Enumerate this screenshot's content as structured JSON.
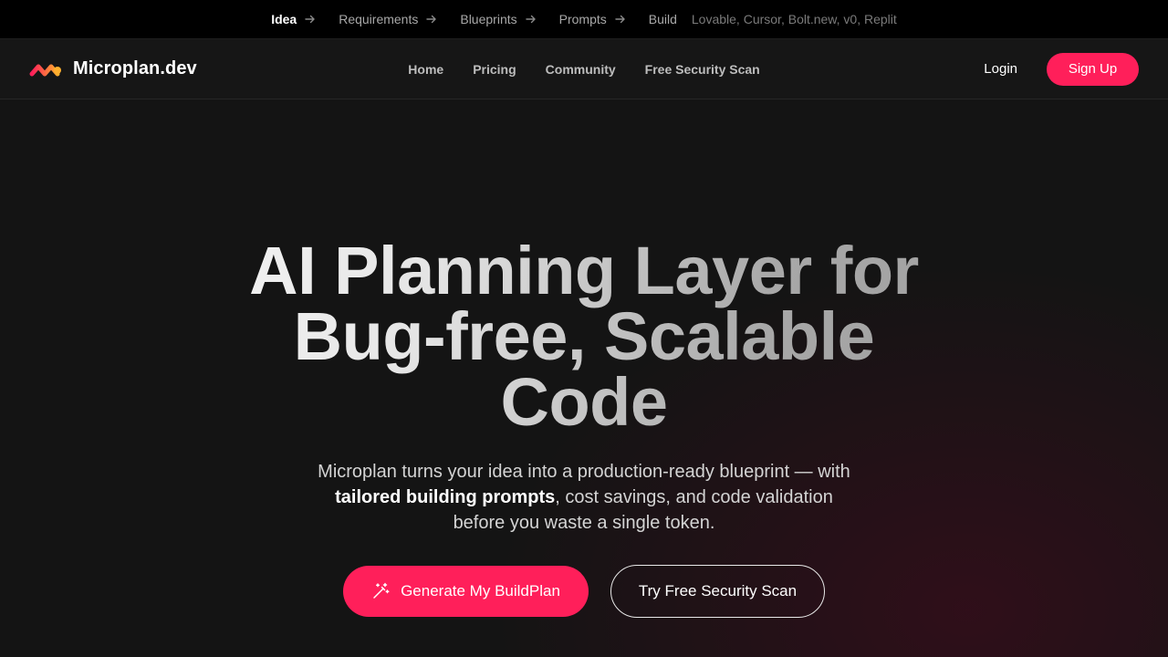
{
  "topbar": {
    "steps": [
      {
        "label": "Idea"
      },
      {
        "label": "Requirements"
      },
      {
        "label": "Blueprints"
      },
      {
        "label": "Prompts"
      },
      {
        "label": "Build"
      }
    ],
    "tools": "Lovable, Cursor, Bolt.new, v0, Replit"
  },
  "nav": {
    "brand": "Microplan.dev",
    "links": [
      "Home",
      "Pricing",
      "Community",
      "Free Security Scan"
    ],
    "login": "Login",
    "signup": "Sign Up"
  },
  "hero": {
    "headline": [
      "AI Planning Layer for",
      "Bug-free, Scalable",
      "Code"
    ],
    "sub_line1": "Microplan turns your idea into a production-ready blueprint — with",
    "sub_bold": "tailored building prompts",
    "sub_line2_rest": ", cost savings, and code validation",
    "sub_line3": "before you waste a single token.",
    "cta_primary": "Generate My BuildPlan",
    "cta_secondary": "Try Free Security Scan"
  },
  "colors": {
    "accent": "#ff1f5a",
    "background": "#141414",
    "topbar": "#000000"
  },
  "icons": {
    "step_arrow": "arrow-right-icon",
    "brand": "microplan-logo-icon",
    "cta": "magic-wand-icon"
  }
}
